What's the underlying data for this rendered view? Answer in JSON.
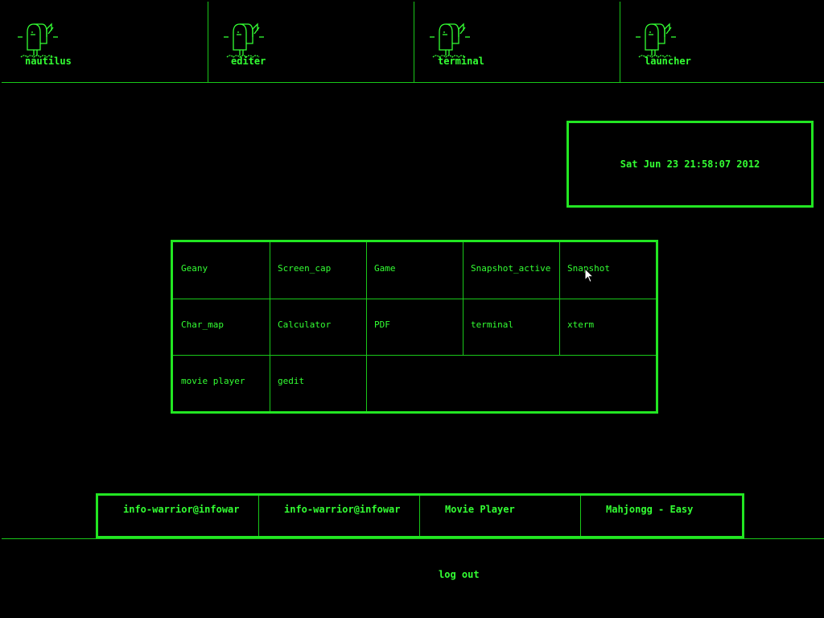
{
  "launcher_bar": {
    "items": [
      {
        "label": "nautilus",
        "icon": "mailbox-icon"
      },
      {
        "label": "editer",
        "icon": "mailbox-icon"
      },
      {
        "label": "terminal",
        "icon": "mailbox-icon"
      },
      {
        "label": "launcher",
        "icon": "mailbox-icon"
      }
    ]
  },
  "clock": {
    "text": "Sat Jun 23 21:58:07 2012"
  },
  "app_grid": {
    "items": [
      {
        "label": "Geany"
      },
      {
        "label": "Screen_cap"
      },
      {
        "label": "Game"
      },
      {
        "label": "Snapshot_active"
      },
      {
        "label": "Snapshot"
      },
      {
        "label": "Char_map"
      },
      {
        "label": "Calculator"
      },
      {
        "label": "PDF"
      },
      {
        "label": "terminal"
      },
      {
        "label": "xterm"
      },
      {
        "label": "movie player"
      },
      {
        "label": "gedit"
      }
    ]
  },
  "taskbar": {
    "tasks": [
      {
        "label": "info-warrior@infowar"
      },
      {
        "label": "info-warrior@infowar"
      },
      {
        "label": "Movie Player"
      },
      {
        "label": "Mahjongg - Easy"
      }
    ]
  },
  "logout": {
    "label": "log out"
  },
  "colors": {
    "background": "#000000",
    "foreground": "#33ff33",
    "border": "#22e622"
  }
}
